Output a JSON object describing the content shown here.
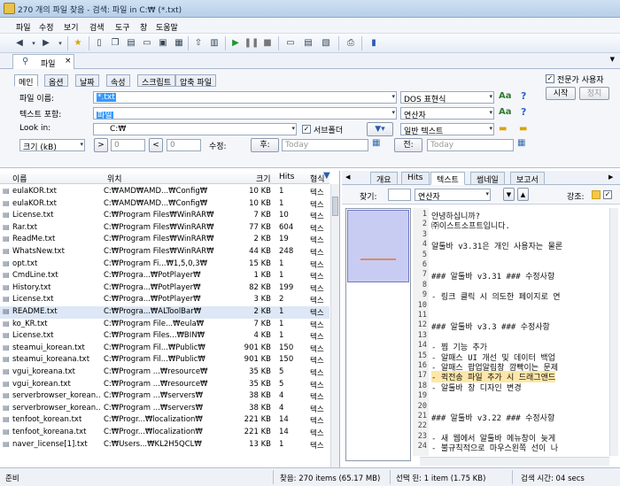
{
  "window": {
    "title": "270 개의 파일 찾음 - 검색: 파일 in C:₩ (*.txt)"
  },
  "menu": [
    "파일",
    "수정",
    "보기",
    "검색",
    "도구",
    "창",
    "도움말"
  ],
  "tab": {
    "label": "파일",
    "close": "×"
  },
  "search_tabs": [
    "메인",
    "옵션",
    "날짜",
    "속성",
    "스크립트",
    "압축 파일"
  ],
  "search": {
    "filename_label": "파일 이름:",
    "filename_value": "*.txt",
    "filename_mode": "DOS 표현식",
    "content_label": "텍스트 포함:",
    "content_value": "파일",
    "content_mode": "연산자",
    "lookin_label": "Look in:",
    "lookin_value": "C:₩",
    "subfolder_label": "서브폴더",
    "subfolder_checked": "✓",
    "text_type": "일반 텍스트",
    "size_label": "크기 (kB)",
    "size_from": "0",
    "size_to": "0",
    "modified_label": "수정:",
    "after_label": "후:",
    "after_placeholder": "Today",
    "before_label": "전:",
    "before_placeholder": "Today",
    "expert_label": "전문가 사용자",
    "expert_checked": "✓",
    "start_label": "시작",
    "stop_label": "정지",
    "aa": "Aa",
    "help": "?"
  },
  "list": {
    "columns": [
      "이름",
      "위치",
      "크기",
      "Hits",
      "형식"
    ],
    "rows": [
      [
        "eulaKOR.txt",
        "C:₩AMD₩AMD...₩Config₩",
        "10 KB",
        "1",
        "텍스"
      ],
      [
        "eulaKOR.txt",
        "C:₩AMD₩AMD...₩Config₩",
        "10 KB",
        "1",
        "텍스"
      ],
      [
        "License.txt",
        "C:₩Program Files₩WinRAR₩",
        "7 KB",
        "10",
        "텍스"
      ],
      [
        "Rar.txt",
        "C:₩Program Files₩WinRAR₩",
        "77 KB",
        "604",
        "텍스"
      ],
      [
        "ReadMe.txt",
        "C:₩Program Files₩WinRAR₩",
        "2 KB",
        "19",
        "텍스"
      ],
      [
        "WhatsNew.txt",
        "C:₩Program Files₩WinRAR₩",
        "44 KB",
        "248",
        "텍스"
      ],
      [
        "opt.txt",
        "C:₩Program Fi...₩1,5,0,3₩",
        "15 KB",
        "1",
        "텍스"
      ],
      [
        "CmdLine.txt",
        "C:₩Progra...₩PotPlayer₩",
        "1 KB",
        "1",
        "텍스"
      ],
      [
        "History.txt",
        "C:₩Progra...₩PotPlayer₩",
        "82 KB",
        "199",
        "텍스"
      ],
      [
        "License.txt",
        "C:₩Progra...₩PotPlayer₩",
        "3 KB",
        "2",
        "텍스"
      ],
      [
        "README.txt",
        "C:₩Progra...₩ALToolBar₩",
        "2 KB",
        "1",
        "텍스"
      ],
      [
        "ko_KR.txt",
        "C:₩Program File...₩eula₩",
        "7 KB",
        "1",
        "텍스"
      ],
      [
        "License.txt",
        "C:₩Program Files...₩BIN₩",
        "4 KB",
        "1",
        "텍스"
      ],
      [
        "steamui_korean.txt",
        "C:₩Program Fil...₩Public₩",
        "901 KB",
        "150",
        "텍스"
      ],
      [
        "steamui_koreana.txt",
        "C:₩Program Fil...₩Public₩",
        "901 KB",
        "150",
        "텍스"
      ],
      [
        "vgui_koreana.txt",
        "C:₩Program ...₩resource₩",
        "35 KB",
        "5",
        "텍스"
      ],
      [
        "vgui_korean.txt",
        "C:₩Program ...₩resource₩",
        "35 KB",
        "5",
        "텍스"
      ],
      [
        "serverbrowser_korean...",
        "C:₩Program ...₩servers₩",
        "38 KB",
        "4",
        "텍스"
      ],
      [
        "serverbrowser_korean...",
        "C:₩Program ...₩servers₩",
        "38 KB",
        "4",
        "텍스"
      ],
      [
        "tenfoot_korean.txt",
        "C:₩Progr...₩localization₩",
        "221 KB",
        "14",
        "텍스"
      ],
      [
        "tenfoot_koreana.txt",
        "C:₩Progr...₩localization₩",
        "221 KB",
        "14",
        "텍스"
      ],
      [
        "naver_license[1].txt",
        "C:₩Users...₩KL2H5QCL₩",
        "13 KB",
        "1",
        "텍스"
      ]
    ]
  },
  "preview_tabs": [
    "개요",
    "Hits",
    "텍스트",
    "썸네일",
    "보고서"
  ],
  "find": {
    "label": "찾기:",
    "mode": "연산자",
    "highlight_label": "강조:"
  },
  "text_lines": [
    {
      "n": "1",
      "t": "안녕하십니까?"
    },
    {
      "n": "2",
      "t": "㈜이스트소프트입니다."
    },
    {
      "n": "3",
      "t": ""
    },
    {
      "n": "4",
      "t": "알툴바 v3.31은 개인 사용자는 물론"
    },
    {
      "n": "5",
      "t": ""
    },
    {
      "n": "6",
      "t": ""
    },
    {
      "n": "7",
      "t": "### 알툴바 v3.31 ###  수정사항"
    },
    {
      "n": "8",
      "t": ""
    },
    {
      "n": "9",
      "t": "- 링크 클릭 시 의도한 페이지로 연"
    },
    {
      "n": "10",
      "t": ""
    },
    {
      "n": "11",
      "t": ""
    },
    {
      "n": "12",
      "t": "### 알툴바 v3.3 ###  수정사항"
    },
    {
      "n": "13",
      "t": ""
    },
    {
      "n": "14",
      "t": "- 찜 기능 추가"
    },
    {
      "n": "15",
      "t": "- 알패스 UI 개선 및 데이터 백업"
    },
    {
      "n": "16",
      "t": "- 알패스 팝업알림창 깜빡이는 문제"
    },
    {
      "n": "17",
      "t": "- 퀵전송 파일 추가 시 드래그앤드"
    },
    {
      "n": "18",
      "t": "- 알툴바 창 디자인 변경"
    },
    {
      "n": "19",
      "t": ""
    },
    {
      "n": "20",
      "t": ""
    },
    {
      "n": "21",
      "t": "### 알툴바 v3.22 ###  수정사항"
    },
    {
      "n": "22",
      "t": ""
    },
    {
      "n": "23",
      "t": "- 새 웹에서 알툴바 메뉴창이 늦게"
    },
    {
      "n": "24",
      "t": "- 불규칙적으로 마우스왼쪽 선이 나"
    }
  ],
  "status": {
    "ready": "준비",
    "found": "찾음: 270 items (65.17 MB)",
    "selected": "선택 된: 1 item (1.75 KB)",
    "time": "검색 시간: 04 secs"
  },
  "colors": {
    "selection": "#3399ff",
    "highlight": "#fde7a8",
    "accent": "#3264c8"
  }
}
